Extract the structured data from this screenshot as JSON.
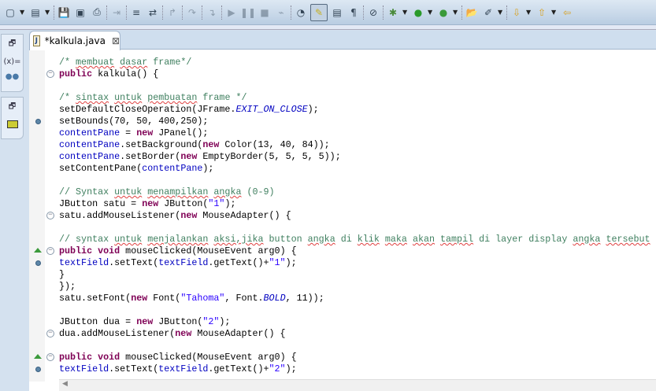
{
  "toolbar": {
    "icons": [
      "new-icon",
      "new-dropdown",
      "new-class-icon",
      "new-class-dropdown",
      "save-icon",
      "save-all-icon",
      "print-icon",
      "step-into-selection-icon",
      "use-step-filters-icon",
      "toggle-step-icon",
      "step-return-icon",
      "step-over-icon",
      "drop-to-frame-icon",
      "resume-icon",
      "suspend-icon",
      "terminate-icon",
      "disconnect-icon",
      "open-type-icon",
      "toggle-mark-occurrences-icon",
      "toggle-block-selection-icon",
      "show-whitespace-icon",
      "skip-breakpoints-icon",
      "debug-icon",
      "run-icon",
      "external-tools-icon",
      "open-folder-icon",
      "search-icon",
      "next-annotation-icon",
      "previous-annotation-icon",
      "back-icon"
    ]
  },
  "editor": {
    "tab_title": "*kalkula.java",
    "lines": [
      {
        "t": [
          [
            "c",
            "/* "
          ],
          [
            "c sq",
            "membuat"
          ],
          [
            "c",
            " "
          ],
          [
            "c sq",
            "dasar"
          ],
          [
            "c",
            " frame*/"
          ]
        ]
      },
      {
        "g": "fold",
        "t": [
          [
            "k",
            "public"
          ],
          [
            "",
            " kalkula() {"
          ]
        ]
      },
      {
        "t": []
      },
      {
        "t": [
          [
            "c",
            "/* "
          ],
          [
            "c sq",
            "sintax"
          ],
          [
            "c",
            " "
          ],
          [
            "c sq",
            "untuk"
          ],
          [
            "c",
            " "
          ],
          [
            "c sq",
            "pembuatan"
          ],
          [
            "c",
            " frame */"
          ]
        ]
      },
      {
        "t": [
          [
            "",
            "setDefaultCloseOperation(JFrame."
          ],
          [
            "st",
            "EXIT_ON_CLOSE"
          ],
          [
            "",
            ");"
          ]
        ]
      },
      {
        "g": "dot",
        "t": [
          [
            "",
            "setBounds(70, 50, 400,250);"
          ]
        ]
      },
      {
        "t": [
          [
            "f",
            "contentPane"
          ],
          [
            "",
            " = "
          ],
          [
            "k",
            "new"
          ],
          [
            "",
            " JPanel();"
          ]
        ]
      },
      {
        "t": [
          [
            "f",
            "contentPane"
          ],
          [
            "",
            ".setBackground("
          ],
          [
            "k",
            "new"
          ],
          [
            "",
            " Color(13, 40, 84));"
          ]
        ]
      },
      {
        "t": [
          [
            "f",
            "contentPane"
          ],
          [
            "",
            ".setBorder("
          ],
          [
            "k",
            "new"
          ],
          [
            "",
            " EmptyBorder(5, 5, 5, 5));"
          ]
        ]
      },
      {
        "t": [
          [
            "",
            "setContentPane("
          ],
          [
            "f",
            "contentPane"
          ],
          [
            "",
            ");"
          ]
        ]
      },
      {
        "t": []
      },
      {
        "t": [
          [
            "c",
            "// Syntax "
          ],
          [
            "c sq",
            "untuk"
          ],
          [
            "c",
            " "
          ],
          [
            "c sq",
            "menampilkan"
          ],
          [
            "c",
            " "
          ],
          [
            "c sq",
            "angka"
          ],
          [
            "c",
            " (0-9)"
          ]
        ]
      },
      {
        "t": [
          [
            "",
            "JButton satu = "
          ],
          [
            "k",
            "new"
          ],
          [
            "",
            " JButton("
          ],
          [
            "s",
            "\"1\""
          ],
          [
            "",
            ");"
          ]
        ]
      },
      {
        "g": "fold",
        "t": [
          [
            "",
            "satu.addMouseListener("
          ],
          [
            "k",
            "new"
          ],
          [
            "",
            " MouseAdapter() {"
          ]
        ]
      },
      {
        "t": []
      },
      {
        "t": [
          [
            "c",
            "// syntax "
          ],
          [
            "c sq",
            "untuk"
          ],
          [
            "c",
            " "
          ],
          [
            "c sq",
            "menjalankan"
          ],
          [
            "c",
            " "
          ],
          [
            "c sq",
            "aksi,jika"
          ],
          [
            "c",
            " button "
          ],
          [
            "c sq",
            "angka"
          ],
          [
            "c",
            " di "
          ],
          [
            "c sq",
            "klik"
          ],
          [
            "c",
            " "
          ],
          [
            "c sq",
            "maka"
          ],
          [
            "c",
            " "
          ],
          [
            "c sq",
            "akan"
          ],
          [
            "c",
            " "
          ],
          [
            "c sq",
            "tampil"
          ],
          [
            "c",
            " di layer display "
          ],
          [
            "c sq",
            "angka"
          ],
          [
            "c",
            " "
          ],
          [
            "c sq",
            "tersebut"
          ]
        ]
      },
      {
        "g": "fold ovr",
        "t": [
          [
            "k",
            "public"
          ],
          [
            "",
            " "
          ],
          [
            "k",
            "void"
          ],
          [
            "",
            " mouseClicked(MouseEvent arg0) {"
          ]
        ]
      },
      {
        "g": "dot",
        "t": [
          [
            "f",
            "textField"
          ],
          [
            "",
            ".setText("
          ],
          [
            "f",
            "textField"
          ],
          [
            "",
            ".getText()+"
          ],
          [
            "s",
            "\"1\""
          ],
          [
            "",
            ");"
          ]
        ]
      },
      {
        "t": [
          [
            "",
            "}"
          ]
        ]
      },
      {
        "t": [
          [
            "",
            "});"
          ]
        ]
      },
      {
        "t": [
          [
            "",
            "satu.setFont("
          ],
          [
            "k",
            "new"
          ],
          [
            "",
            " Font("
          ],
          [
            "s",
            "\"Tahoma\""
          ],
          [
            "",
            ", Font."
          ],
          [
            "st",
            "BOLD"
          ],
          [
            "",
            ", 11));"
          ]
        ]
      },
      {
        "t": []
      },
      {
        "t": [
          [
            "",
            "JButton dua = "
          ],
          [
            "k",
            "new"
          ],
          [
            "",
            " JButton("
          ],
          [
            "s",
            "\"2\""
          ],
          [
            "",
            ");"
          ]
        ]
      },
      {
        "g": "fold",
        "t": [
          [
            "",
            "dua.addMouseListener("
          ],
          [
            "k",
            "new"
          ],
          [
            "",
            " MouseAdapter() {"
          ]
        ]
      },
      {
        "t": []
      },
      {
        "g": "fold ovr",
        "t": [
          [
            "k",
            "public"
          ],
          [
            "",
            " "
          ],
          [
            "k",
            "void"
          ],
          [
            "",
            " mouseClicked(MouseEvent arg0) {"
          ]
        ]
      },
      {
        "g": "dot",
        "t": [
          [
            "f",
            "textField"
          ],
          [
            "",
            ".setText("
          ],
          [
            "f",
            "textField"
          ],
          [
            "",
            ".getText()+"
          ],
          [
            "s",
            "\"2\""
          ],
          [
            "",
            ");"
          ]
        ]
      }
    ]
  },
  "left_panel": {
    "variables_label": "(x)="
  },
  "scroll_left": "◀"
}
